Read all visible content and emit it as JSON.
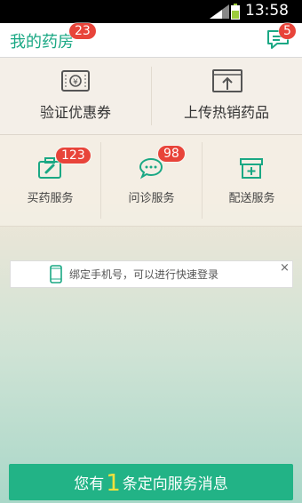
{
  "status_bar": {
    "time": "13:58"
  },
  "header": {
    "title": "我的药房",
    "title_badge": "23",
    "message_badge": "5"
  },
  "top_actions": [
    {
      "label": "验证优惠券",
      "icon": "coupon-icon"
    },
    {
      "label": "上传热销药品",
      "icon": "upload-icon"
    }
  ],
  "services": [
    {
      "label": "买药服务",
      "icon": "medicine-bag-icon",
      "badge": "123"
    },
    {
      "label": "问诊服务",
      "icon": "chat-bubble-icon",
      "badge": "98"
    },
    {
      "label": "配送服务",
      "icon": "delivery-box-icon",
      "badge": ""
    }
  ],
  "bind_phone": {
    "text": "绑定手机号，可以进行快速登录",
    "close": "×"
  },
  "message_button": {
    "prefix": "您有",
    "count": "1",
    "suffix": "条定向服务消息"
  },
  "colors": {
    "brand_green": "#1aa884",
    "badge_red": "#e8443a",
    "button_green": "#22b386",
    "highlight_yellow": "#f5e13c"
  }
}
